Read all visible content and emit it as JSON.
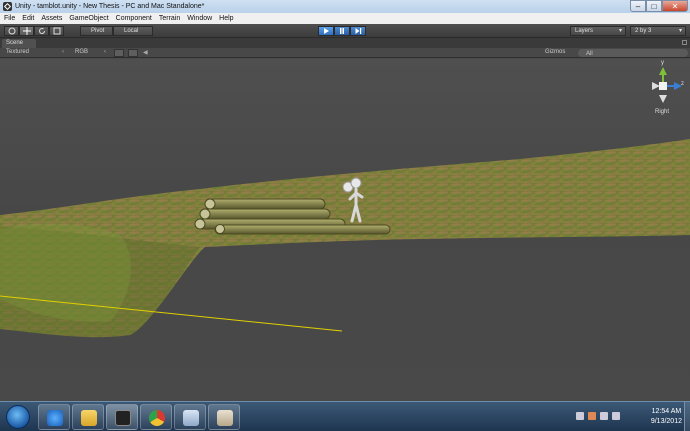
{
  "window": {
    "title": "Unity - tamblot.unity - New Thesis - PC and Mac Standalone*",
    "minimize": "–",
    "maximize": "□",
    "close": "✕"
  },
  "menu": [
    "File",
    "Edit",
    "Assets",
    "GameObject",
    "Component",
    "Terrain",
    "Window",
    "Help"
  ],
  "toolbar": {
    "pivot": "Pivot",
    "local": "Local",
    "layers": "Layers",
    "layout": "2 by 3"
  },
  "scene": {
    "tab": "Scene",
    "render_mode": "Textured",
    "color_mode": "RGB",
    "gizmos": "Gizmos",
    "search_placeholder": "All",
    "view_label": "Right",
    "axis_y": "y",
    "axis_z": "z"
  },
  "taskbar": {
    "time": "12:54 AM",
    "date": "9/13/2012",
    "apps": [
      "internet-explorer",
      "file-explorer",
      "unity",
      "chrome",
      "remote-desktop",
      "paint"
    ]
  },
  "colors": {
    "accent": "#2f6fbf",
    "terrain": "#7a7a3a",
    "guide_line": "#e0d000"
  }
}
